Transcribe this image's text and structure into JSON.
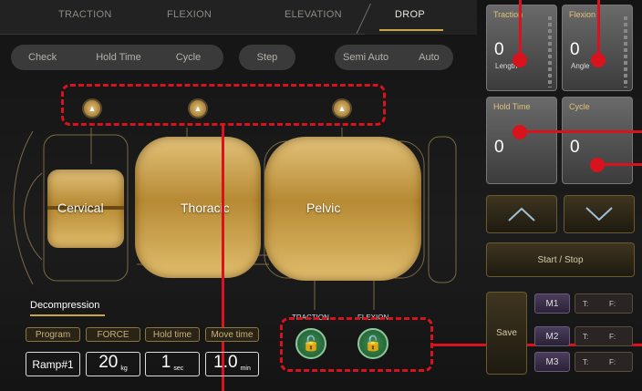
{
  "tabs": [
    {
      "label": "TRACTION"
    },
    {
      "label": "FLEXION"
    },
    {
      "label": "ELEVATION"
    },
    {
      "label": "DROP",
      "active": true
    }
  ],
  "mode_bar": {
    "check": "Check",
    "hold_time": "Hold Time",
    "cycle": "Cycle",
    "step": "Step",
    "semi_auto": "Semi Auto",
    "auto": "Auto"
  },
  "segments": {
    "cervical": "Cervical",
    "thoracic": "Thoracic",
    "pelvic": "Pelvic"
  },
  "axis_labels": {
    "traction": "TRACTION",
    "flexion": "FLEXION"
  },
  "decompression": {
    "title": "Decompression",
    "headers": [
      "Program",
      "FORCE",
      "Hold time",
      "Move time"
    ],
    "program_value": "Ramp#1",
    "force": {
      "value": "20",
      "unit": "kg"
    },
    "hold": {
      "value": "1",
      "unit": "sec"
    },
    "move": {
      "value": "1.0",
      "unit": "min"
    }
  },
  "right_panel": {
    "traction": {
      "label": "Traction",
      "value": "0",
      "sub": "Length"
    },
    "flexion": {
      "label": "Flexion",
      "value": "0",
      "sub": "Angle"
    },
    "hold_time": {
      "label": "Hold Time",
      "value": "0"
    },
    "cycle": {
      "label": "Cycle",
      "value": "0"
    },
    "start_stop": "Start / Stop",
    "save": "Save",
    "memories": [
      {
        "label": "M1",
        "t": "T:",
        "f": "F:"
      },
      {
        "label": "M2",
        "t": "T:",
        "f": "F:"
      },
      {
        "label": "M3",
        "t": "T:",
        "f": "F:"
      }
    ]
  },
  "colors": {
    "accent_gold": "#c9a54c",
    "annotation_red": "#d9131e",
    "lock_green": "#2f7a44"
  }
}
